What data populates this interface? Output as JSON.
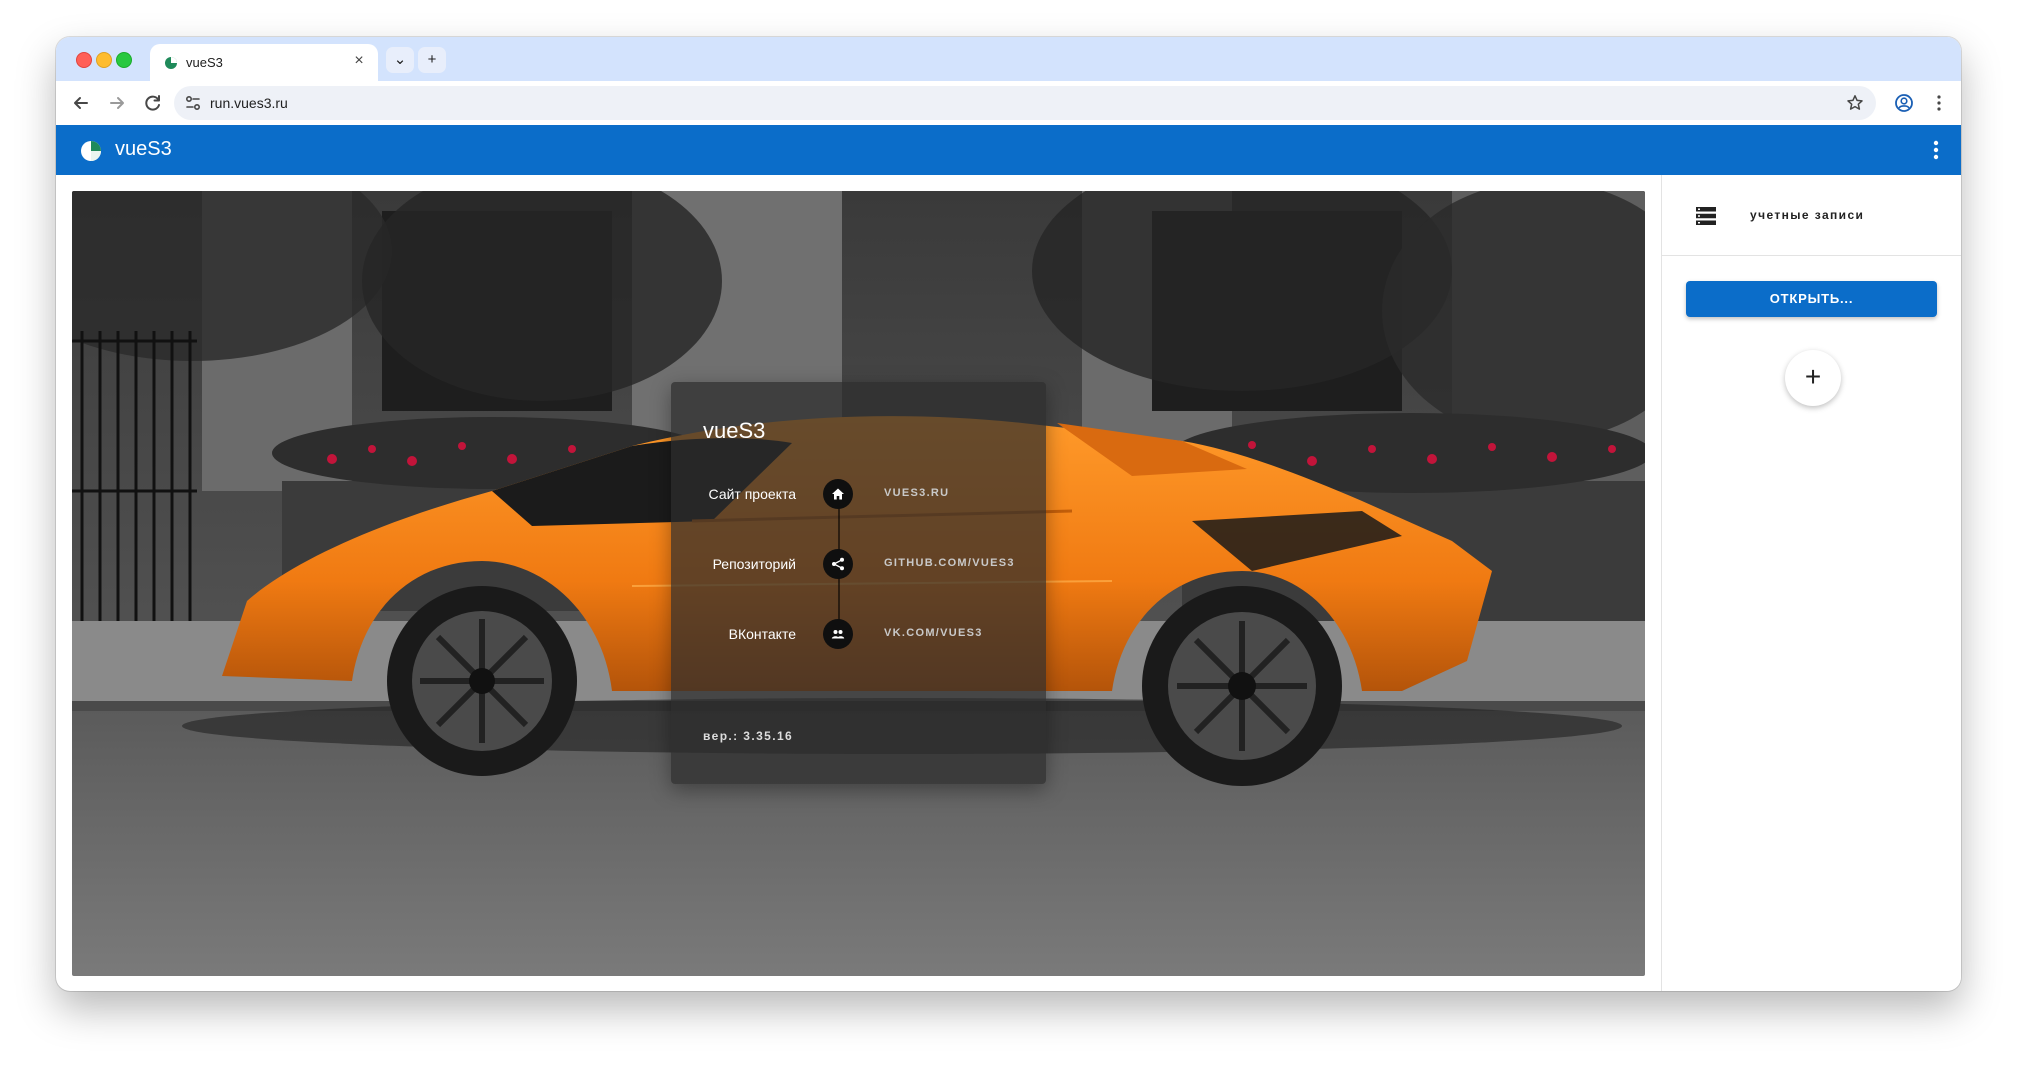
{
  "browser": {
    "tab_title": "vueS3",
    "tab_close": "×",
    "tab_menu": "⌄",
    "new_tab": "+",
    "url": "run.vues3.ru"
  },
  "app": {
    "title": "vueS3"
  },
  "card": {
    "title": "vueS3",
    "rows": [
      {
        "label": "Сайт проекта",
        "icon": "home-icon",
        "link": "VUES3.RU"
      },
      {
        "label": "Репозиторий",
        "icon": "share-icon",
        "link": "GITHUB.COM/VUES3"
      },
      {
        "label": "ВКонтакте",
        "icon": "group-icon",
        "link": "VK.COM/VUES3"
      }
    ],
    "version": "вер.: 3.35.16"
  },
  "sidebar": {
    "accounts_label": "учетные записи",
    "open_button": "ОТКРЫТЬ...",
    "add_button": "+"
  },
  "colors": {
    "tabstrip": "#d3e3fd",
    "appbar": "#0b6dc9",
    "car_orange": "#f07a12"
  }
}
